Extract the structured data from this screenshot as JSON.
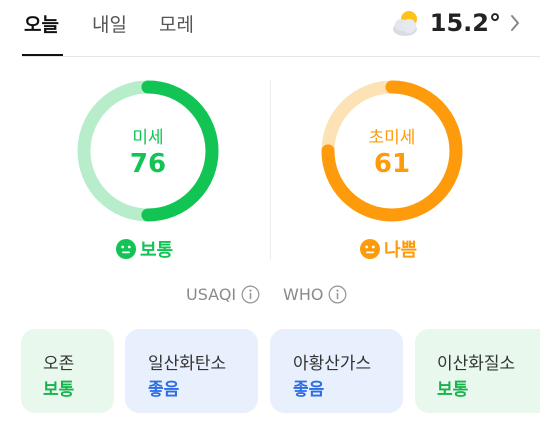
{
  "tabs": [
    {
      "label": "오늘",
      "active": true
    },
    {
      "label": "내일",
      "active": false
    },
    {
      "label": "모레",
      "active": false
    }
  ],
  "weather": {
    "icon": "partly-cloudy-icon",
    "temperature": "15.2°"
  },
  "gauges": [
    {
      "label": "미세",
      "value": "76",
      "fraction": 0.5,
      "status": "보통",
      "color": "#12c453",
      "track": "#b8edcb"
    },
    {
      "label": "초미세",
      "value": "61",
      "fraction": 0.75,
      "status": "나쁨",
      "color": "#fd9b0c",
      "track": "#fde2b6"
    }
  ],
  "standards": [
    "USAQI",
    "WHO"
  ],
  "pollutants": [
    {
      "name": "오존",
      "status": "보통"
    },
    {
      "name": "일산화탄소",
      "status": "좋음"
    },
    {
      "name": "아황산가스",
      "status": "좋음"
    },
    {
      "name": "이산화질소",
      "status": "보통"
    }
  ],
  "colors": {
    "normal_text": "#17b34c",
    "good_text": "#2c6de6",
    "normal_card": "#e8f8ed",
    "good_card": "#e9f0fd"
  }
}
